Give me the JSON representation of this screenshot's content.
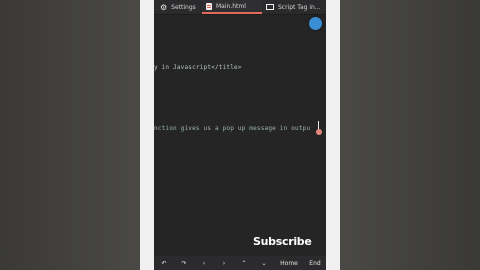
{
  "tabs": [
    {
      "label": "Settings",
      "icon": "gear-icon"
    },
    {
      "label": "Main.html",
      "icon": "file-icon",
      "active": true
    },
    {
      "label": "Script Tag in...",
      "icon": "terminal-icon"
    }
  ],
  "editor": {
    "line1": "y in Javascript</title>",
    "line2": "nction gives us a pop up message in outpu"
  },
  "overlay": {
    "subscribe": "Subscribe"
  },
  "toolbar": {
    "undo": "↶",
    "redo": "↷",
    "left": "‹",
    "right": "›",
    "up": "⌃",
    "down": "⌄",
    "home": "Home",
    "end": "End"
  },
  "colors": {
    "accent_tab": "#e16b5b",
    "fab": "#3a8fd4",
    "editor_bg": "#252526"
  }
}
